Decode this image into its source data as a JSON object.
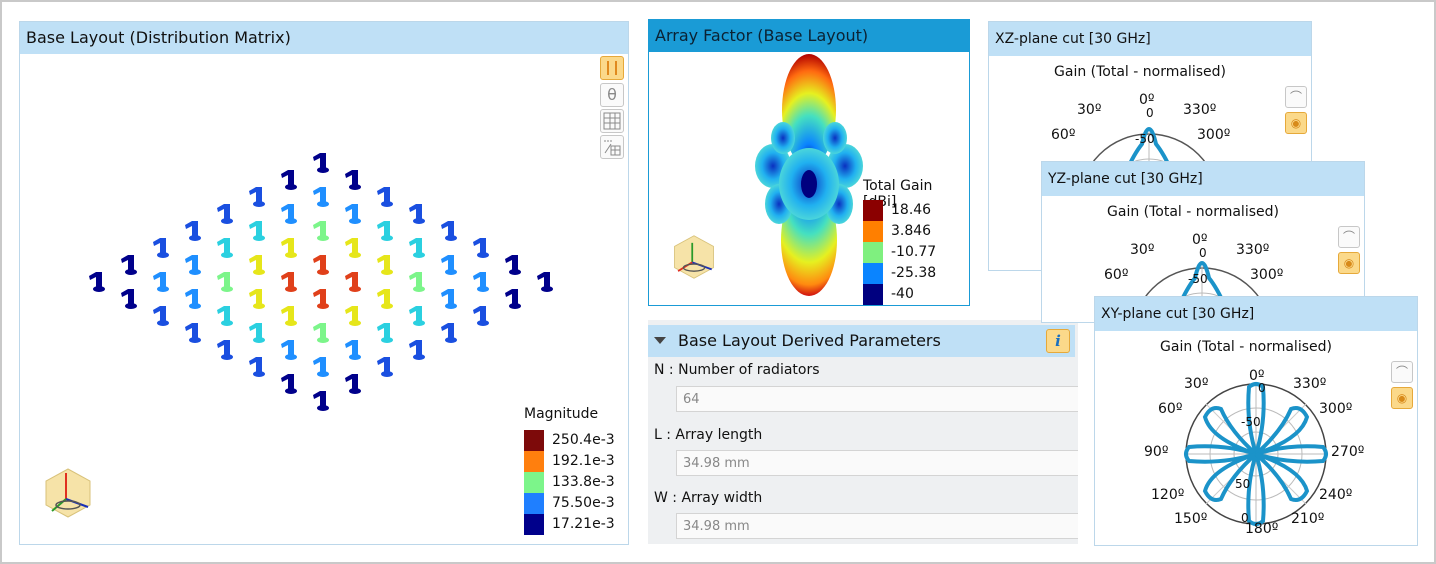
{
  "layout_panel": {
    "title": "Base Layout (Distribution Matrix)",
    "legend_title": "Magnitude",
    "legend": [
      {
        "label": "250.4e-3",
        "color": "#7d0a0a"
      },
      {
        "label": "192.1e-3",
        "color": "#ff7f0e"
      },
      {
        "label": "133.8e-3",
        "color": "#7cf58a"
      },
      {
        "label": "75.50e-3",
        "color": "#1f7fff"
      },
      {
        "label": "17.21e-3",
        "color": "#00008b"
      }
    ],
    "toolbar": [
      "array-icon",
      "theta-icon",
      "grid-icon",
      "scale-grid-icon"
    ]
  },
  "array_factor": {
    "title": "Array Factor (Base Layout)",
    "legend_title": "Total Gain [dBi]",
    "legend": [
      {
        "label": "18.46",
        "color": "#8b0000"
      },
      {
        "label": "3.846",
        "color": "#ff7f00"
      },
      {
        "label": "-10.77",
        "color": "#7ff07f"
      },
      {
        "label": "-25.38",
        "color": "#0a84ff"
      },
      {
        "label": "-40",
        "color": "#00007f"
      }
    ]
  },
  "params": {
    "title": "Base Layout Derived Parameters",
    "items": [
      {
        "label": "N : Number of radiators",
        "value": "64"
      },
      {
        "label": "L : Array length",
        "value": "34.98 mm"
      },
      {
        "label": "W : Array width",
        "value": "34.98 mm"
      }
    ]
  },
  "xz": {
    "title": "XZ-plane cut [30 GHz]",
    "subtitle": "Gain (Total - normalised)",
    "angles": [
      "0º",
      "30º",
      "330º",
      "60º",
      "300º"
    ],
    "ring": "-50",
    "zero": "0"
  },
  "yz": {
    "title": "YZ-plane cut [30 GHz]",
    "subtitle": "Gain (Total - normalised)",
    "angles": [
      "0º",
      "30º",
      "330º",
      "60º",
      "300º"
    ],
    "ring": "-50",
    "zero": "0"
  },
  "xy": {
    "title": "XY-plane cut [30 GHz]",
    "subtitle": "Gain (Total - normalised)",
    "angles": {
      "a0": "0º",
      "a30": "30º",
      "a330": "330º",
      "a60": "60º",
      "a300": "300º",
      "a90": "90º",
      "a270": "270º",
      "a120": "120º",
      "a240": "240º",
      "a150": "150º",
      "a210": "210º",
      "a180": "180º"
    },
    "ring_neg50": "-50",
    "ring_50": "50",
    "zero_top": "0",
    "zero_bottom": "0"
  }
}
